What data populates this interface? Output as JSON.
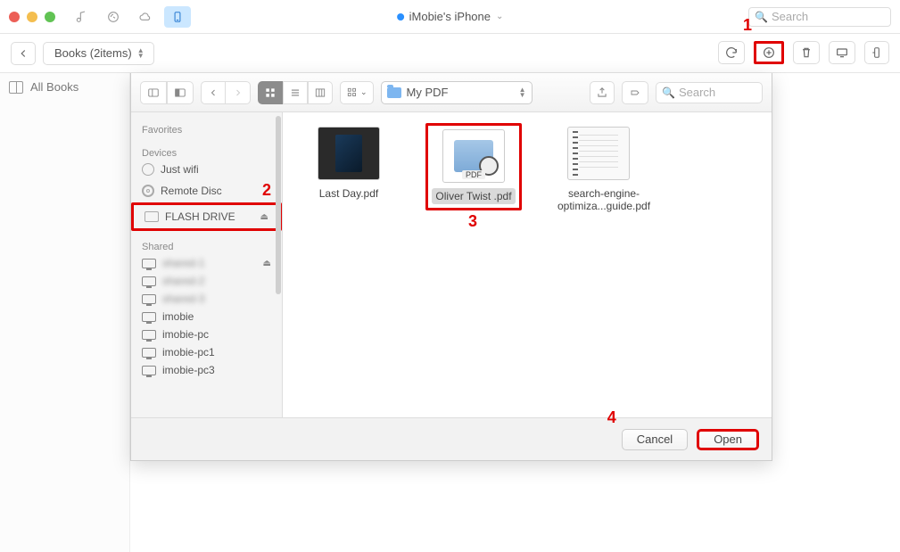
{
  "titlebar": {
    "device_title": "iMobie's iPhone",
    "search_placeholder": "Search"
  },
  "toolbar": {
    "books_label": "Books (2items)"
  },
  "sidebar_main": {
    "all_books_label": "All Books"
  },
  "dialog": {
    "path_label": "My PDF",
    "search_placeholder": "Search",
    "sidebar": {
      "sections": {
        "favorites": "Favorites",
        "devices": "Devices",
        "shared": "Shared"
      },
      "devices": [
        {
          "label": "Just wifi"
        },
        {
          "label": "Remote Disc"
        },
        {
          "label": "FLASH DRIVE"
        }
      ],
      "shared": [
        {
          "label": "shared-1",
          "blurred": true
        },
        {
          "label": "shared-2",
          "blurred": true
        },
        {
          "label": "shared-3",
          "blurred": true
        },
        {
          "label": "imobie"
        },
        {
          "label": "imobie-pc"
        },
        {
          "label": "imobie-pc1"
        },
        {
          "label": "imobie-pc3"
        }
      ]
    },
    "files": [
      {
        "name": "Last Day.pdf",
        "thumb": "dark"
      },
      {
        "name": "Oliver Twist .pdf",
        "thumb": "pdf",
        "selected": true
      },
      {
        "name": "search-engine-optimiza...guide.pdf",
        "thumb": "paper"
      }
    ],
    "footer": {
      "cancel": "Cancel",
      "open": "Open"
    },
    "pdf_tag": "PDF"
  },
  "annotations": {
    "n1": "1",
    "n2": "2",
    "n3": "3",
    "n4": "4"
  }
}
